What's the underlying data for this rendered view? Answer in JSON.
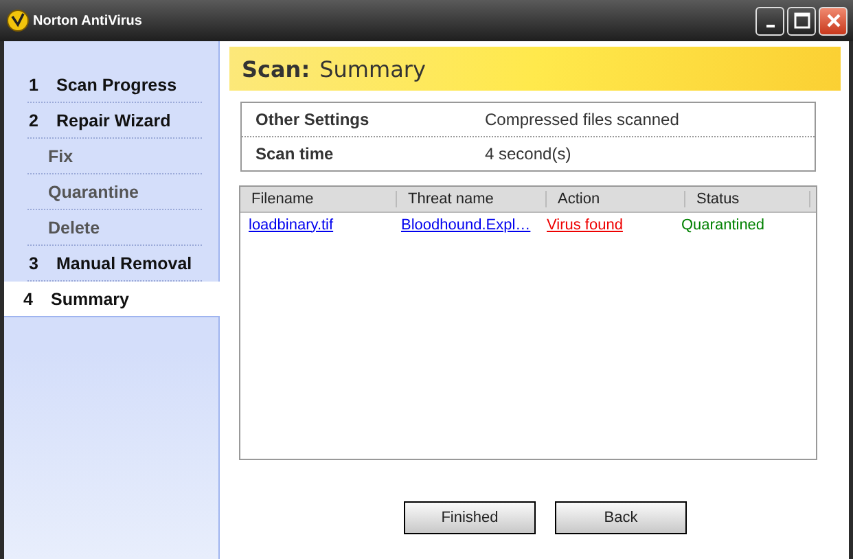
{
  "window": {
    "title": "Norton AntiVirus"
  },
  "sidebar": {
    "items": [
      {
        "number": "1",
        "label": "Scan Progress",
        "selected": false
      },
      {
        "number": "2",
        "label": "Repair Wizard",
        "selected": false,
        "children": [
          {
            "label": "Fix",
            "disabled": true
          },
          {
            "label": "Quarantine",
            "disabled": true
          },
          {
            "label": "Delete",
            "disabled": true
          }
        ]
      },
      {
        "number": "3",
        "label": "Manual Removal",
        "selected": false
      },
      {
        "number": "4",
        "label": "Summary",
        "selected": true
      }
    ]
  },
  "header": {
    "title": "Scan:",
    "subtitle": "Summary"
  },
  "settings": [
    {
      "label": "Other Settings",
      "value": "Compressed files scanned"
    },
    {
      "label": "Scan time",
      "value": "4 second(s)"
    }
  ],
  "table": {
    "columns": [
      "Filename",
      "Threat name",
      "Action",
      "Status"
    ],
    "rows": [
      [
        {
          "text": "loadbinary.tif",
          "kind": "link"
        },
        {
          "text": "Bloodhound.Expl…",
          "kind": "link"
        },
        {
          "text": "Virus found",
          "kind": "alert"
        },
        {
          "text": "Quarantined",
          "kind": "ok"
        }
      ]
    ]
  },
  "buttons": [
    "Finished",
    "Back"
  ]
}
